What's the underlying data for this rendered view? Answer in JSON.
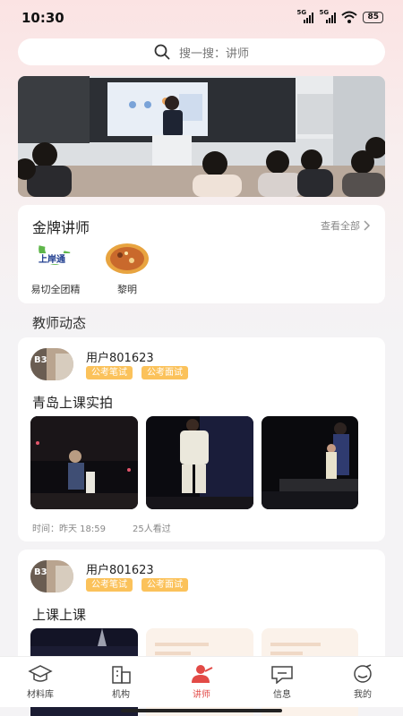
{
  "status": {
    "time": "10:30",
    "sim1": "5G",
    "sim2": "5G",
    "battery": "85"
  },
  "search": {
    "placeholder": "搜一搜：讲师"
  },
  "gold": {
    "title": "金牌讲师",
    "view_all": "查看全部",
    "teachers": [
      {
        "name": "易切全团精",
        "logo_text": "上岸通"
      },
      {
        "name": "黎明"
      }
    ]
  },
  "dynamics": {
    "title": "教师动态"
  },
  "posts": [
    {
      "user": "用户801623",
      "avatar_text": "B3",
      "tags": [
        "公考笔试",
        "公考面试"
      ],
      "title": "青岛上课实拍",
      "time": "时间：昨天 18:59",
      "views": "25人看过"
    },
    {
      "user": "用户801623",
      "avatar_text": "B3",
      "tags": [
        "公考笔试",
        "公考面试"
      ],
      "title": "上课上课"
    }
  ],
  "nav": [
    {
      "label": "材料库",
      "icon": "graduation-cap-icon"
    },
    {
      "label": "机构",
      "icon": "building-icon"
    },
    {
      "label": "讲师",
      "icon": "teacher-icon",
      "active": true
    },
    {
      "label": "信息",
      "icon": "message-icon"
    },
    {
      "label": "我的",
      "icon": "profile-face-icon"
    }
  ],
  "colors": {
    "accent": "#e24a46",
    "tag": "#fbc25b"
  }
}
